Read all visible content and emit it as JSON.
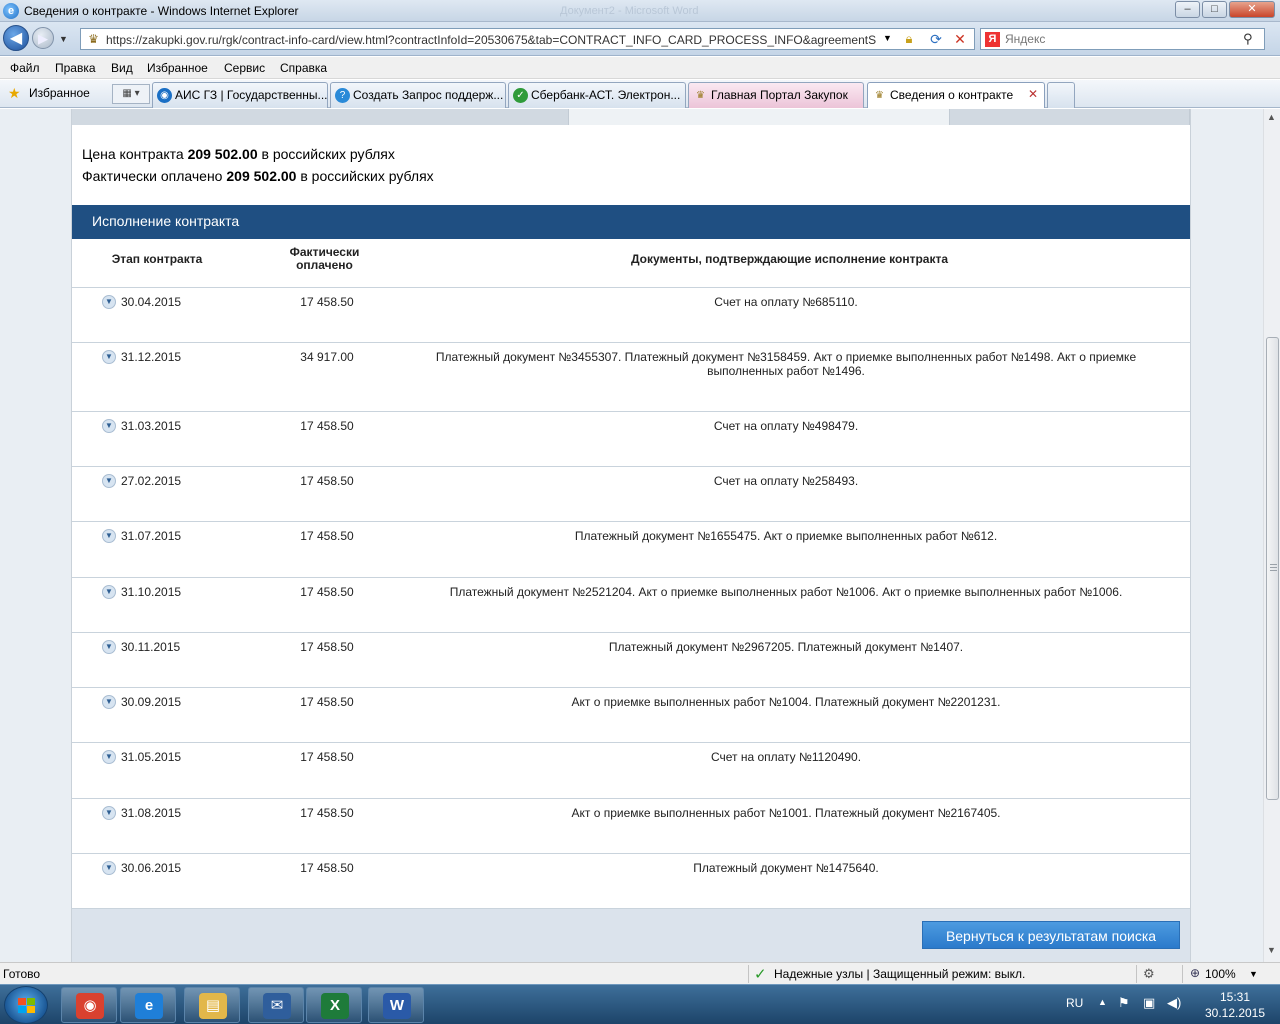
{
  "window": {
    "title": "Сведения о контракте - Windows Internet Explorer",
    "background_title": "Документ2 - Microsoft Word",
    "buttons": {
      "minimize": "–",
      "maximize": "□",
      "close": "✕"
    }
  },
  "address": {
    "url": "https://zakupki.gov.ru/rgk/contract-info-card/view.html?contractInfoId=20530675&tab=CONTRACT_INFO_CARD_PROCESS_INFO&agreementSea"
  },
  "search": {
    "placeholder": "Яндекс",
    "brand_glyph": "Я"
  },
  "menu": [
    "Файл",
    "Правка",
    "Вид",
    "Избранное",
    "Сервис",
    "Справка"
  ],
  "favorites": {
    "label": "Избранное"
  },
  "tabs": [
    {
      "label": "АИС ГЗ | Государственны...",
      "icon": "globe-icon",
      "color": "#1a6fc5"
    },
    {
      "label": "Создать Запрос поддерж...",
      "icon": "help-icon",
      "color": "#2a8ad8"
    },
    {
      "label": "Сбербанк-АСТ. Электрон...",
      "icon": "sberbank-icon",
      "color": "#2f9b3a"
    },
    {
      "label": "Главная Портал Закупок",
      "icon": "emblem-icon",
      "color": "#9a7b22"
    },
    {
      "label": "Сведения о контракте",
      "icon": "emblem-icon",
      "color": "#9a7b22"
    }
  ],
  "contract": {
    "price_label": "Цена контракта",
    "price_value": "209 502.00",
    "price_suffix": "в российских рублях",
    "paid_label": "Фактически оплачено",
    "paid_value": "209 502.00",
    "paid_suffix": "в российских рублях"
  },
  "section": {
    "title": "Исполнение контракта",
    "columns": {
      "stage": "Этап контракта",
      "paid": "Фактически оплачено",
      "docs": "Документы, подтверждающие исполнение контракта"
    },
    "rows": [
      {
        "date": "30.04.2015",
        "paid": "17 458.50",
        "docs": "Счет на оплату №685110."
      },
      {
        "date": "31.12.2015",
        "paid": "34 917.00",
        "docs": "Платежный документ №3455307. Платежный документ №3158459. Акт о приемке выполненных работ №1498. Акт о приемке выполненных работ №1496."
      },
      {
        "date": "31.03.2015",
        "paid": "17 458.50",
        "docs": "Счет на оплату №498479."
      },
      {
        "date": "27.02.2015",
        "paid": "17 458.50",
        "docs": "Счет на оплату №258493."
      },
      {
        "date": "31.07.2015",
        "paid": "17 458.50",
        "docs": "Платежный документ №1655475. Акт о приемке выполненных работ №612."
      },
      {
        "date": "31.10.2015",
        "paid": "17 458.50",
        "docs": "Платежный документ №2521204. Акт о приемке выполненных работ №1006. Акт о приемке выполненных работ №1006."
      },
      {
        "date": "30.11.2015",
        "paid": "17 458.50",
        "docs": "Платежный документ №2967205. Платежный документ №1407."
      },
      {
        "date": "30.09.2015",
        "paid": "17 458.50",
        "docs": "Акт о приемке выполненных работ №1004. Платежный документ №2201231."
      },
      {
        "date": "31.05.2015",
        "paid": "17 458.50",
        "docs": "Счет на оплату №1120490."
      },
      {
        "date": "31.08.2015",
        "paid": "17 458.50",
        "docs": "Акт о приемке выполненных работ №1001. Платежный документ №2167405."
      },
      {
        "date": "30.06.2015",
        "paid": "17 458.50",
        "docs": "Платежный документ №1475640."
      }
    ],
    "back_button": "Вернуться к результатам поиска"
  },
  "status": {
    "ready": "Готово",
    "zone": "Надежные узлы | Защищенный режим: выкл.",
    "zoom": "100%"
  },
  "taskbar": {
    "apps": [
      {
        "name": "chrome-icon",
        "glyph": "◉",
        "color": "#d9412f"
      },
      {
        "name": "ie-icon",
        "glyph": "e",
        "color": "#1f7fd8"
      },
      {
        "name": "explorer-folder-icon",
        "glyph": "▤",
        "color": "#e2b74a"
      },
      {
        "name": "thunderbird-icon",
        "glyph": "✉",
        "color": "#2f5e9c"
      },
      {
        "name": "excel-icon",
        "glyph": "X",
        "color": "#1e7b3a"
      },
      {
        "name": "word-icon",
        "glyph": "W",
        "color": "#2a5aa8"
      }
    ],
    "lang": "RU",
    "time": "15:31",
    "date": "30.12.2015"
  }
}
